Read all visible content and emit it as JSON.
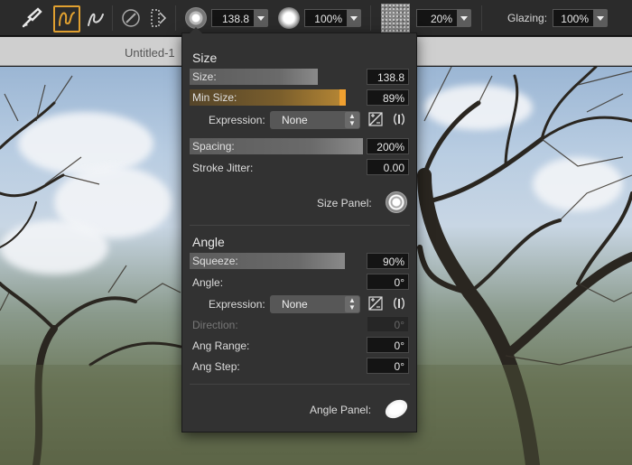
{
  "toolbar": {
    "size_value": "138.8",
    "opacity_value": "100%",
    "grain_value": "20%",
    "glazing_label": "Glazing:",
    "glazing_value": "100%",
    "icons": [
      "brush-category-icon",
      "freehand-stroke-icon",
      "quick-curve-icon",
      "brush-ghost-icon",
      "dab-preview-icon",
      "size-dial-icon",
      "opacity-dial-icon",
      "grain-texture-icon"
    ]
  },
  "document": {
    "tab_title": "Untitled-1"
  },
  "panel": {
    "size_section": {
      "title": "Size",
      "size": {
        "label": "Size:",
        "value": "138.8",
        "fill": 0.72
      },
      "min_size": {
        "label": "Min Size:",
        "value": "89%",
        "fill": 0.89
      },
      "expression": {
        "label": "Expression:",
        "value": "None"
      },
      "spacing": {
        "label": "Spacing:",
        "value": "200%",
        "fill": 1.0
      },
      "stroke_jitter": {
        "label": "Stroke Jitter:",
        "value": "0.00"
      },
      "panel_link": "Size Panel:"
    },
    "angle_section": {
      "title": "Angle",
      "squeeze": {
        "label": "Squeeze:",
        "value": "90%",
        "fill": 0.9
      },
      "angle": {
        "label": "Angle:",
        "value": "0°"
      },
      "expression": {
        "label": "Expression:",
        "value": "None"
      },
      "direction": {
        "label": "Direction:",
        "value": "0°"
      },
      "ang_range": {
        "label": "Ang Range:",
        "value": "0°"
      },
      "ang_step": {
        "label": "Ang Step:",
        "value": "0°"
      },
      "panel_link": "Angle Panel:"
    }
  },
  "colors": {
    "accent": "#f0a030",
    "panel_bg": "#323232",
    "toolbar_bg": "#2b2b2b"
  }
}
